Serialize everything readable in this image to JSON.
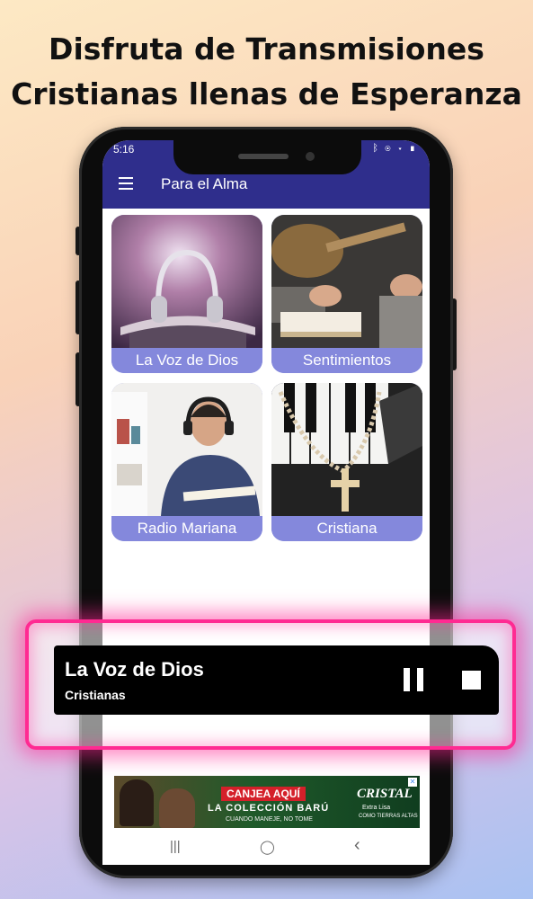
{
  "headline": {
    "line1": "Disfruta de Transmisiones",
    "line2": "Cristianas llenas de Esperanza"
  },
  "status_bar": {
    "time": "5:16",
    "icons_right": "ᛒ ◉ ▾ ▮"
  },
  "app_bar": {
    "title": "Para el Alma"
  },
  "tiles": [
    {
      "label": "La Voz de Dios",
      "icon": "headphones-on-bible-image"
    },
    {
      "label": "Sentimientos",
      "icon": "praying-hands-guitar-image"
    },
    {
      "label": "Radio Mariana",
      "icon": "man-with-headphones-image"
    },
    {
      "label": "Cristiana",
      "icon": "rosary-on-piano-image"
    }
  ],
  "player": {
    "title": "La Voz de Dios",
    "subtitle": "Cristianas",
    "pause_icon": "pause-icon",
    "stop_icon": "stop-icon"
  },
  "ad": {
    "cta": "CANJEA AQUÍ",
    "line2": "LA COLECCIÓN BARÚ",
    "line3": "CUANDO MANEJE, NO TOME",
    "brand": "CRISTAL",
    "brand_tag": "Extra Lisa",
    "brand_tag2": "COMO TIERRAS ALTAS",
    "close": "✕"
  },
  "nav": {
    "recent": "|||",
    "home": "◯",
    "back": "‹"
  },
  "colors": {
    "appbar": "#2f2e8c",
    "tile_caption": "#8488dc",
    "glow": "#ff2a92"
  }
}
